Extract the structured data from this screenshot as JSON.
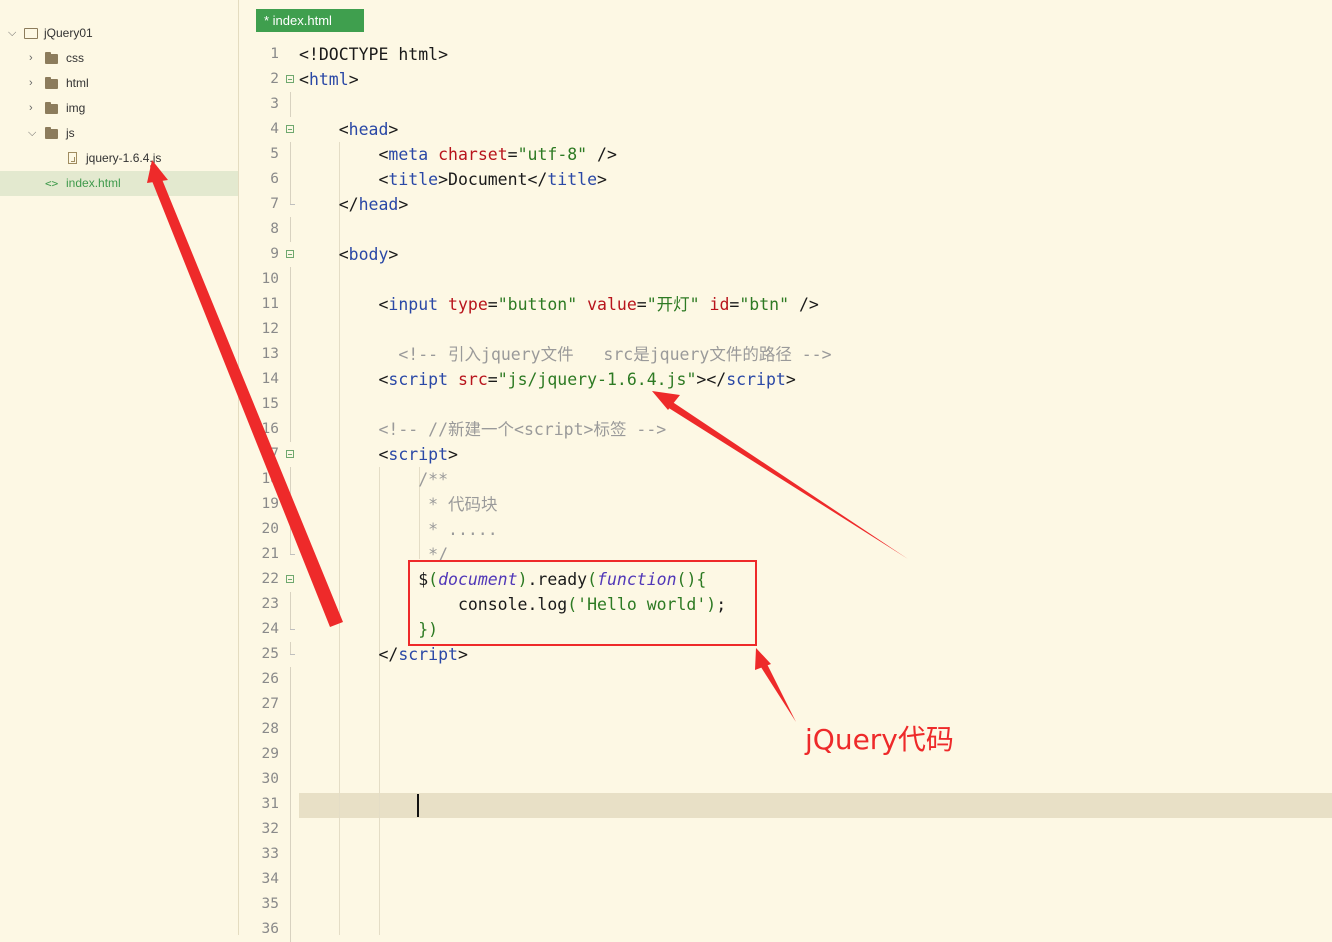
{
  "sidebar": {
    "items": [
      {
        "label": "jQuery01",
        "depth": 0,
        "icon": "project-folder-icon",
        "expanded": true
      },
      {
        "label": "css",
        "depth": 1,
        "icon": "folder-icon",
        "expanded": false
      },
      {
        "label": "html",
        "depth": 1,
        "icon": "folder-icon",
        "expanded": false
      },
      {
        "label": "img",
        "depth": 1,
        "icon": "folder-icon",
        "expanded": false
      },
      {
        "label": "js",
        "depth": 1,
        "icon": "folder-open-icon",
        "expanded": true
      },
      {
        "label": "jquery-1.6.4.js",
        "depth": 2,
        "icon": "js-file-icon"
      },
      {
        "label": "index.html",
        "depth": 1,
        "icon": "html-tag-icon",
        "selected": true
      }
    ]
  },
  "editor": {
    "tab_label": "* index.html",
    "cursor_line": 31,
    "lines": [
      {
        "n": "1",
        "fold": "",
        "code": [
          [
            "c-def",
            "<!DOCTYPE html>"
          ]
        ]
      },
      {
        "n": "2",
        "fold": "open",
        "code": [
          [
            "c-def",
            "<"
          ],
          [
            "c-tag",
            "html"
          ],
          [
            "c-def",
            ">"
          ]
        ]
      },
      {
        "n": "3",
        "fold": "bar",
        "code": []
      },
      {
        "n": "4",
        "fold": "open",
        "code": [
          [
            "c-def",
            "    <"
          ],
          [
            "c-tag",
            "head"
          ],
          [
            "c-def",
            ">"
          ]
        ]
      },
      {
        "n": "5",
        "fold": "bar",
        "code": [
          [
            "c-def",
            "        <"
          ],
          [
            "c-tag",
            "meta"
          ],
          [
            "c-def",
            " "
          ],
          [
            "c-attr",
            "charset"
          ],
          [
            "c-def",
            "="
          ],
          [
            "c-str",
            "\"utf-8\""
          ],
          [
            "c-def",
            " />"
          ]
        ]
      },
      {
        "n": "6",
        "fold": "bar",
        "code": [
          [
            "c-def",
            "        <"
          ],
          [
            "c-tag",
            "title"
          ],
          [
            "c-def",
            ">Document</"
          ],
          [
            "c-tag",
            "title"
          ],
          [
            "c-def",
            ">"
          ]
        ]
      },
      {
        "n": "7",
        "fold": "end",
        "code": [
          [
            "c-def",
            "    </"
          ],
          [
            "c-tag",
            "head"
          ],
          [
            "c-def",
            ">"
          ]
        ]
      },
      {
        "n": "8",
        "fold": "bar",
        "code": []
      },
      {
        "n": "9",
        "fold": "open",
        "code": [
          [
            "c-def",
            "    <"
          ],
          [
            "c-tag",
            "body"
          ],
          [
            "c-def",
            ">"
          ]
        ]
      },
      {
        "n": "10",
        "fold": "bar",
        "code": []
      },
      {
        "n": "11",
        "fold": "bar",
        "code": [
          [
            "c-def",
            "        <"
          ],
          [
            "c-tag",
            "input"
          ],
          [
            "c-def",
            " "
          ],
          [
            "c-attr",
            "type"
          ],
          [
            "c-def",
            "="
          ],
          [
            "c-str",
            "\"button\""
          ],
          [
            "c-def",
            " "
          ],
          [
            "c-attr",
            "value"
          ],
          [
            "c-def",
            "="
          ],
          [
            "c-str",
            "\"开灯\""
          ],
          [
            "c-def",
            " "
          ],
          [
            "c-attr",
            "id"
          ],
          [
            "c-def",
            "="
          ],
          [
            "c-str",
            "\"btn\""
          ],
          [
            "c-def",
            " />"
          ]
        ]
      },
      {
        "n": "12",
        "fold": "bar",
        "code": []
      },
      {
        "n": "13",
        "fold": "bar",
        "code": [
          [
            "c-com",
            "          <!-- 引入jquery文件   src是jquery文件的路径 -->"
          ]
        ]
      },
      {
        "n": "14",
        "fold": "bar",
        "code": [
          [
            "c-def",
            "        <"
          ],
          [
            "c-tag",
            "script"
          ],
          [
            "c-def",
            " "
          ],
          [
            "c-attr",
            "src"
          ],
          [
            "c-def",
            "="
          ],
          [
            "c-str",
            "\"js/jquery-1.6.4.js\""
          ],
          [
            "c-def",
            "></"
          ],
          [
            "c-tag",
            "script"
          ],
          [
            "c-def",
            ">"
          ]
        ]
      },
      {
        "n": "15",
        "fold": "bar",
        "code": []
      },
      {
        "n": "16",
        "fold": "bar",
        "code": [
          [
            "c-com",
            "        <!-- //新建一个<script>标签 -->"
          ]
        ]
      },
      {
        "n": "17",
        "fold": "open",
        "code": [
          [
            "c-def",
            "        <"
          ],
          [
            "c-tag",
            "script"
          ],
          [
            "c-def",
            ">"
          ]
        ]
      },
      {
        "n": "18",
        "fold": "bar",
        "code": [
          [
            "c-com",
            "            /**"
          ]
        ]
      },
      {
        "n": "19",
        "fold": "bar",
        "code": [
          [
            "c-com",
            "             * 代码块"
          ]
        ]
      },
      {
        "n": "20",
        "fold": "bar",
        "code": [
          [
            "c-com",
            "             * ....."
          ]
        ]
      },
      {
        "n": "21",
        "fold": "end",
        "code": [
          [
            "c-com",
            "             */"
          ]
        ]
      },
      {
        "n": "22",
        "fold": "open",
        "code": [
          [
            "c-def",
            "            $"
          ],
          [
            "c-brk",
            "("
          ],
          [
            "c-kw",
            "document"
          ],
          [
            "c-brk",
            ")"
          ],
          [
            "c-def",
            ".ready"
          ],
          [
            "c-brk",
            "("
          ],
          [
            "c-kw",
            "function"
          ],
          [
            "c-brk",
            "(){"
          ]
        ]
      },
      {
        "n": "23",
        "fold": "bar",
        "code": [
          [
            "c-def",
            "                console.log"
          ],
          [
            "c-brk",
            "("
          ],
          [
            "c-str",
            "'Hello world'"
          ],
          [
            "c-brk",
            ")"
          ],
          [
            "c-def",
            ";"
          ]
        ]
      },
      {
        "n": "24",
        "fold": "end",
        "code": [
          [
            "c-brk",
            "            })"
          ]
        ]
      },
      {
        "n": "25",
        "fold": "end",
        "code": [
          [
            "c-def",
            "        </"
          ],
          [
            "c-tag",
            "script"
          ],
          [
            "c-def",
            ">"
          ]
        ]
      },
      {
        "n": "26",
        "fold": "bar",
        "code": []
      },
      {
        "n": "27",
        "fold": "bar",
        "code": []
      },
      {
        "n": "28",
        "fold": "bar",
        "code": []
      },
      {
        "n": "29",
        "fold": "bar",
        "code": []
      },
      {
        "n": "30",
        "fold": "bar",
        "code": []
      },
      {
        "n": "31",
        "fold": "bar",
        "code": []
      },
      {
        "n": "32",
        "fold": "bar",
        "code": []
      },
      {
        "n": "33",
        "fold": "bar",
        "code": []
      },
      {
        "n": "34",
        "fold": "bar",
        "code": []
      },
      {
        "n": "35",
        "fold": "bar",
        "code": []
      },
      {
        "n": "36",
        "fold": "bar",
        "code": []
      }
    ]
  },
  "annotation": {
    "label": "jQuery代码",
    "color": "#ee2a2a"
  },
  "colors": {
    "background": "#fdf8e4",
    "tab": "#3f9f4e",
    "selected_row": "#e3e9cf"
  }
}
